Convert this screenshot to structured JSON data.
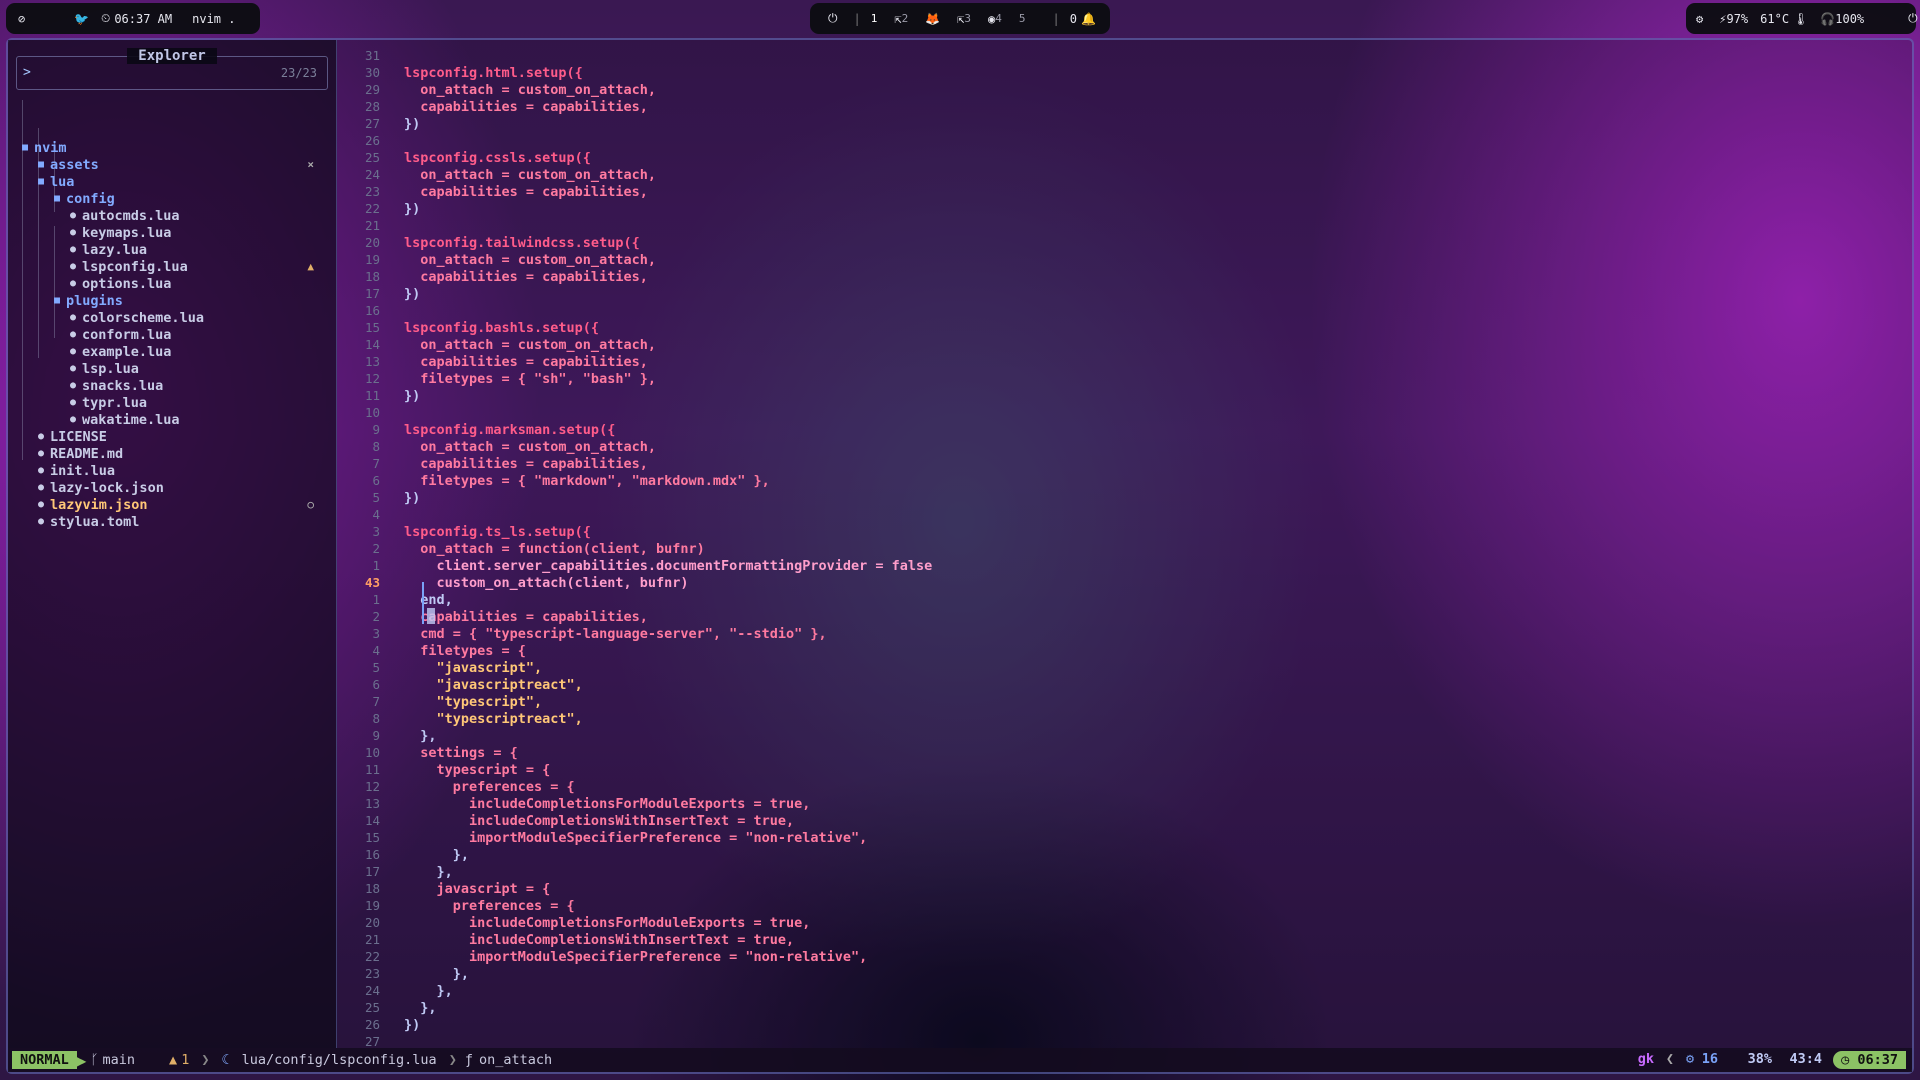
{
  "topbar": {
    "left": {
      "icon": "eye-off-icon",
      "bird_icon": "bird-icon",
      "time": "06:37 AM",
      "app": "nvim ."
    },
    "center": {
      "workspaces": [
        {
          "label": "1",
          "suffix": "⇱",
          "active": true
        },
        {
          "label": "2",
          "suffix": "🦊",
          "active": false
        },
        {
          "label": "",
          "suffix": "⇱",
          "active": false
        },
        {
          "label": "3",
          "suffix": "◉",
          "active": false
        },
        {
          "label": "4",
          "suffix": "",
          "active": false
        },
        {
          "label": "5",
          "suffix": "",
          "active": false
        }
      ],
      "notifications": "0"
    },
    "right": {
      "cpu": "97%",
      "temp": "61°C",
      "volume": "100%"
    }
  },
  "explorer": {
    "title": "Explorer",
    "prompt": ">",
    "count": "23/23",
    "items": [
      {
        "label": "nvim",
        "kind": "dir",
        "depth": 0,
        "tag": ""
      },
      {
        "label": "assets",
        "kind": "dir",
        "depth": 1,
        "tag": "×"
      },
      {
        "label": "lua",
        "kind": "dir",
        "depth": 1,
        "tag": ""
      },
      {
        "label": "config",
        "kind": "dir",
        "depth": 2,
        "tag": ""
      },
      {
        "label": "autocmds.lua",
        "kind": "file",
        "depth": 3,
        "tag": ""
      },
      {
        "label": "keymaps.lua",
        "kind": "file",
        "depth": 3,
        "tag": ""
      },
      {
        "label": "lazy.lua",
        "kind": "file",
        "depth": 3,
        "tag": ""
      },
      {
        "label": "lspconfig.lua",
        "kind": "file",
        "depth": 3,
        "tag": "▲"
      },
      {
        "label": "options.lua",
        "kind": "file",
        "depth": 3,
        "tag": ""
      },
      {
        "label": "plugins",
        "kind": "dir",
        "depth": 2,
        "tag": ""
      },
      {
        "label": "colorscheme.lua",
        "kind": "file",
        "depth": 3,
        "tag": ""
      },
      {
        "label": "conform.lua",
        "kind": "file",
        "depth": 3,
        "tag": ""
      },
      {
        "label": "example.lua",
        "kind": "file",
        "depth": 3,
        "tag": ""
      },
      {
        "label": "lsp.lua",
        "kind": "file",
        "depth": 3,
        "tag": ""
      },
      {
        "label": "snacks.lua",
        "kind": "file",
        "depth": 3,
        "tag": ""
      },
      {
        "label": "typr.lua",
        "kind": "file",
        "depth": 3,
        "tag": ""
      },
      {
        "label": "wakatime.lua",
        "kind": "file",
        "depth": 3,
        "tag": ""
      },
      {
        "label": "LICENSE",
        "kind": "file",
        "depth": 1,
        "tag": ""
      },
      {
        "label": "README.md",
        "kind": "file",
        "depth": 1,
        "tag": ""
      },
      {
        "label": "init.lua",
        "kind": "file",
        "depth": 1,
        "tag": ""
      },
      {
        "label": "lazy-lock.json",
        "kind": "file",
        "depth": 1,
        "tag": ""
      },
      {
        "label": "lazyvim.json",
        "kind": "file",
        "depth": 1,
        "tag": "○"
      },
      {
        "label": "stylua.toml",
        "kind": "file",
        "depth": 1,
        "tag": ""
      }
    ]
  },
  "editor": {
    "lines": [
      {
        "n": "31",
        "t": ""
      },
      {
        "n": "30",
        "t": "lspconfig.html.setup({"
      },
      {
        "n": "29",
        "t": "  on_attach = custom_on_attach,"
      },
      {
        "n": "28",
        "t": "  capabilities = capabilities,"
      },
      {
        "n": "27",
        "t": "})"
      },
      {
        "n": "26",
        "t": ""
      },
      {
        "n": "25",
        "t": "lspconfig.cssls.setup({"
      },
      {
        "n": "24",
        "t": "  on_attach = custom_on_attach,"
      },
      {
        "n": "23",
        "t": "  capabilities = capabilities,"
      },
      {
        "n": "22",
        "t": "})"
      },
      {
        "n": "21",
        "t": ""
      },
      {
        "n": "20",
        "t": "lspconfig.tailwindcss.setup({"
      },
      {
        "n": "19",
        "t": "  on_attach = custom_on_attach,"
      },
      {
        "n": "18",
        "t": "  capabilities = capabilities,"
      },
      {
        "n": "17",
        "t": "})"
      },
      {
        "n": "16",
        "t": ""
      },
      {
        "n": "15",
        "t": "lspconfig.bashls.setup({"
      },
      {
        "n": "14",
        "t": "  on_attach = custom_on_attach,"
      },
      {
        "n": "13",
        "t": "  capabilities = capabilities,"
      },
      {
        "n": "12",
        "t": "  filetypes = { \"sh\", \"bash\" },"
      },
      {
        "n": "11",
        "t": "})"
      },
      {
        "n": "10",
        "t": ""
      },
      {
        "n": "9",
        "t": "lspconfig.marksman.setup({"
      },
      {
        "n": "8",
        "t": "  on_attach = custom_on_attach,"
      },
      {
        "n": "7",
        "t": "  capabilities = capabilities,"
      },
      {
        "n": "6",
        "t": "  filetypes = { \"markdown\", \"markdown.mdx\" },"
      },
      {
        "n": "5",
        "t": "})"
      },
      {
        "n": "4",
        "t": ""
      },
      {
        "n": "3",
        "t": "lspconfig.ts_ls.setup({"
      },
      {
        "n": "2",
        "t": "  on_attach = function(client, bufnr)"
      },
      {
        "n": "1",
        "t": "    client.server_capabilities.documentFormattingProvider = false"
      },
      {
        "n": "43",
        "t": "    custom_on_attach(client, bufnr)",
        "current": true
      },
      {
        "n": "1",
        "t": "  end,"
      },
      {
        "n": "2",
        "t": "  capabilities = capabilities,"
      },
      {
        "n": "3",
        "t": "  cmd = { \"typescript-language-server\", \"--stdio\" },"
      },
      {
        "n": "4",
        "t": "  filetypes = {"
      },
      {
        "n": "5",
        "t": "    \"javascript\","
      },
      {
        "n": "6",
        "t": "    \"javascriptreact\","
      },
      {
        "n": "7",
        "t": "    \"typescript\","
      },
      {
        "n": "8",
        "t": "    \"typescriptreact\","
      },
      {
        "n": "9",
        "t": "  },"
      },
      {
        "n": "10",
        "t": "  settings = {"
      },
      {
        "n": "11",
        "t": "    typescript = {"
      },
      {
        "n": "12",
        "t": "      preferences = {"
      },
      {
        "n": "13",
        "t": "        includeCompletionsForModuleExports = true,"
      },
      {
        "n": "14",
        "t": "        includeCompletionsWithInsertText = true,"
      },
      {
        "n": "15",
        "t": "        importModuleSpecifierPreference = \"non-relative\","
      },
      {
        "n": "16",
        "t": "      },"
      },
      {
        "n": "17",
        "t": "    },"
      },
      {
        "n": "18",
        "t": "    javascript = {"
      },
      {
        "n": "19",
        "t": "      preferences = {"
      },
      {
        "n": "20",
        "t": "        includeCompletionsForModuleExports = true,"
      },
      {
        "n": "21",
        "t": "        includeCompletionsWithInsertText = true,"
      },
      {
        "n": "22",
        "t": "        importModuleSpecifierPreference = \"non-relative\","
      },
      {
        "n": "23",
        "t": "      },"
      },
      {
        "n": "24",
        "t": "    },"
      },
      {
        "n": "25",
        "t": "  },"
      },
      {
        "n": "26",
        "t": "})"
      },
      {
        "n": "27",
        "t": ""
      }
    ]
  },
  "statusline": {
    "mode": "NORMAL",
    "branch": "main",
    "warnings": "1",
    "path": "lua/config/lspconfig.lua",
    "symbol": "on_attach",
    "right": {
      "typr": "gk",
      "lsp_count": "16",
      "percent": "38%",
      "position": "43:4",
      "clock": "06:37"
    }
  },
  "colors": {
    "mode_bg": "#8cc265",
    "accent": "#82aaff",
    "keyword": "#ff5c8a",
    "string": "#ffc777"
  }
}
